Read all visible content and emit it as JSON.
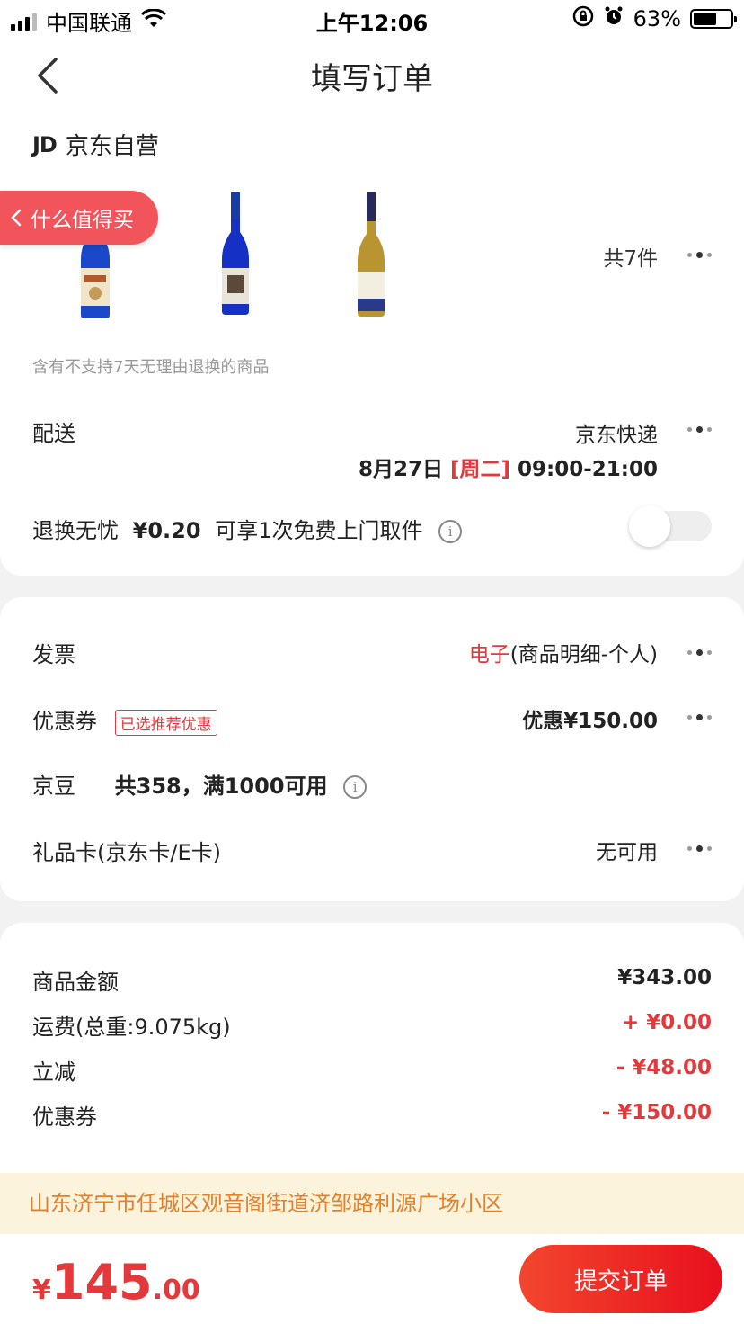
{
  "status_bar": {
    "carrier": "中国联通",
    "time": "上午12:06",
    "battery_percent_label": "63%",
    "battery_level": 0.63
  },
  "nav": {
    "title": "填写订单"
  },
  "shop": {
    "logo": "JD",
    "name": "京东自营"
  },
  "float_tag": "什么值得买",
  "products": {
    "count_label": "共7件",
    "note": "含有不支持7天无理由退换的商品"
  },
  "delivery": {
    "label": "配送",
    "carrier": "京东快递",
    "date": "8月27日",
    "weekday": "[周二]",
    "time_window": "09:00-21:00"
  },
  "return_service": {
    "label": "退换无忧",
    "price": "¥0.20",
    "desc": "可享1次免费上门取件",
    "enabled": false
  },
  "invoice": {
    "label": "发票",
    "type": "电子",
    "detail": "(商品明细-个人)"
  },
  "coupon": {
    "label": "优惠券",
    "badge": "已选推荐优惠",
    "value": "优惠¥150.00"
  },
  "jingdou": {
    "label": "京豆",
    "desc": "共358，满1000可用"
  },
  "gift_card": {
    "label": "礼品卡(京东卡/E卡)",
    "value": "无可用"
  },
  "summary": {
    "goods_label": "商品金额",
    "goods_value": "¥343.00",
    "shipping_label": "运费(总重:9.075kg)",
    "shipping_value": "+ ¥0.00",
    "discount_label": "立减",
    "discount_value": "- ¥48.00",
    "coupon_label": "优惠券",
    "coupon_value": "- ¥150.00"
  },
  "address": "山东济宁市任城区观音阁街道济邹路利源广场小区",
  "footer": {
    "currency": "¥",
    "total_int": "145",
    "total_dec": ".00",
    "submit_label": "提交订单"
  },
  "colors": {
    "accent_red": "#e4393c",
    "address_bg": "#fcf3dd",
    "address_text": "#e4802a",
    "tag_bg": "#f2545b"
  }
}
